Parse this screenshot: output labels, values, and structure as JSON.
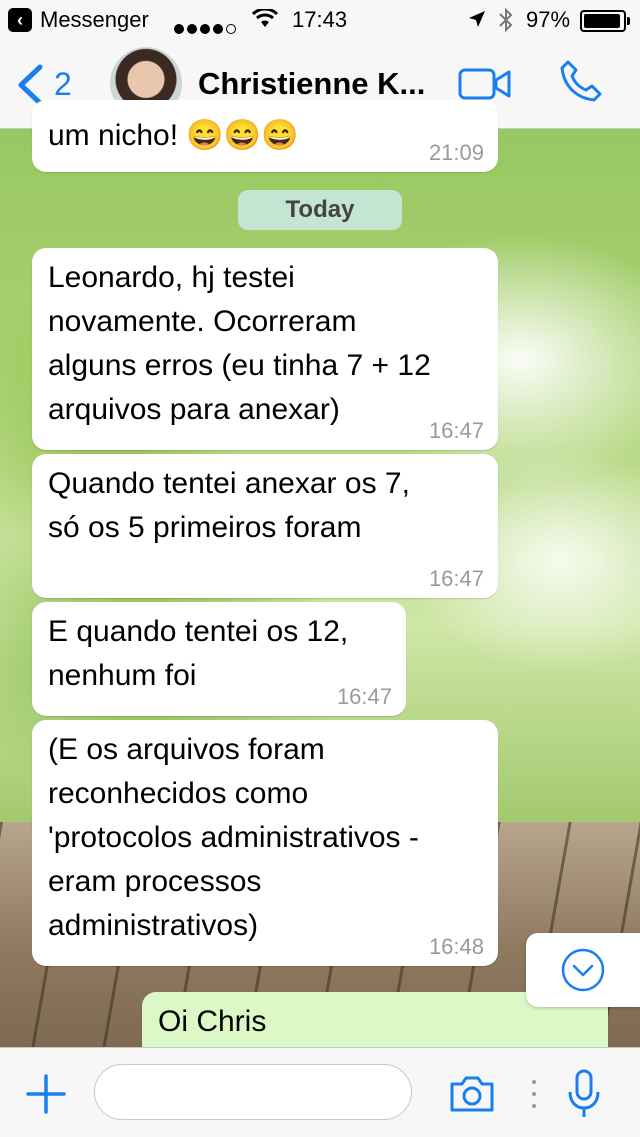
{
  "status_bar": {
    "carrier": "Messenger",
    "time": "17:43",
    "battery": "97%",
    "signal_bars": 4,
    "battery_level": 0.97
  },
  "header": {
    "back_count": "2",
    "contact_name": "Christienne K..."
  },
  "chat": {
    "partial_message": {
      "text": "um nicho! 😄😄😄",
      "time": "21:09"
    },
    "date_separator": "Today",
    "messages": [
      {
        "text": "Leonardo, hj testei\nnovamente. Ocorreram\nalguns erros (eu tinha 7 + 12\narquivos para anexar)",
        "time": "16:47"
      },
      {
        "text": "Quando tentei anexar os 7,\nsó os 5 primeiros foram",
        "time": "16:47"
      },
      {
        "text": "E quando tentei os 12,\nnenhum foi",
        "time": "16:47"
      },
      {
        "text": "(E os arquivos foram\nreconhecidos como\n'protocolos administrativos -\neram processos\nadministrativos)",
        "time": "16:48"
      }
    ],
    "outgoing_partial": {
      "text": "Oi Chris"
    }
  },
  "input": {
    "placeholder": ""
  },
  "colors": {
    "accent": "#1b7ef0",
    "incoming_bubble": "#ffffff",
    "outgoing_bubble": "#dcf8c6"
  },
  "icons": [
    "back-app-icon",
    "wifi-icon",
    "location-icon",
    "bluetooth-icon",
    "battery-icon",
    "back-chevron-icon",
    "video-call-icon",
    "phone-icon",
    "scroll-down-icon",
    "plus-icon",
    "camera-icon",
    "microphone-icon"
  ]
}
